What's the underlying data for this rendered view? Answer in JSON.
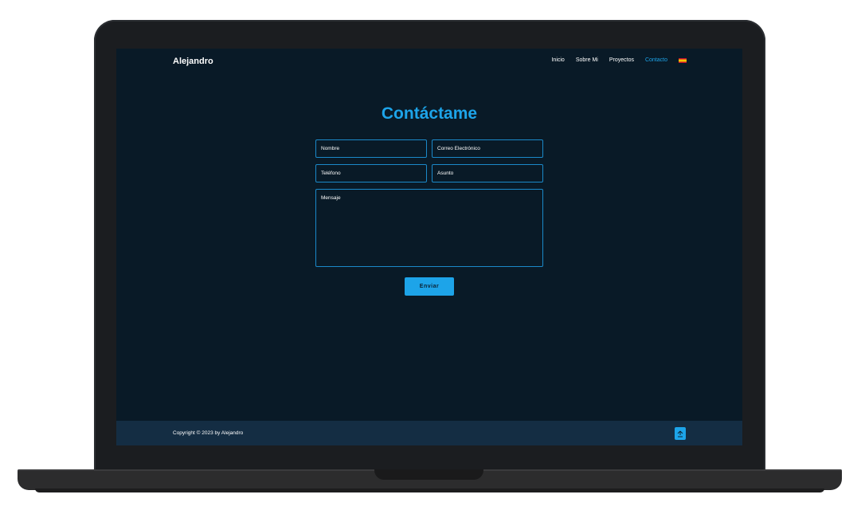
{
  "navbar": {
    "brand": "Alejandro",
    "links": [
      {
        "label": "Inicio",
        "active": false
      },
      {
        "label": "Sobre Mi",
        "active": false
      },
      {
        "label": "Proyectos",
        "active": false
      },
      {
        "label": "Contacto",
        "active": true
      }
    ],
    "language_icon": "spain-flag-icon"
  },
  "contact": {
    "title": "Contáctame",
    "fields": {
      "name_placeholder": "Nombre",
      "email_placeholder": "Correo Electrónico",
      "phone_placeholder": "Teléfono",
      "subject_placeholder": "Asunto",
      "message_placeholder": "Mensaje"
    },
    "send_label": "Enviar"
  },
  "footer": {
    "copyright": "Copyright © 2023 by Alejandro",
    "scroll_top_icon": "arrow-up-icon"
  },
  "colors": {
    "background": "#091a27",
    "accent": "#1da4e9",
    "footer": "#142d43"
  }
}
